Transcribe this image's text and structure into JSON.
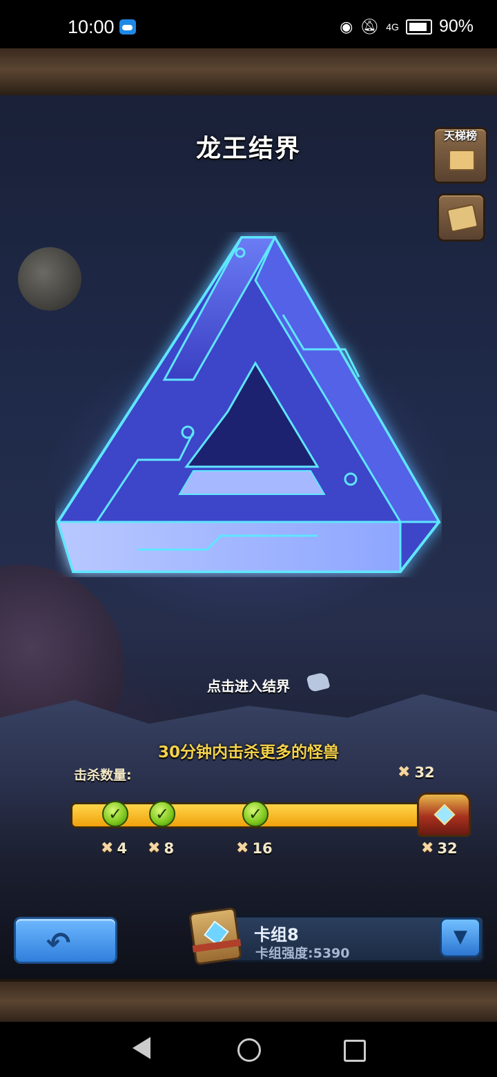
{
  "status_bar": {
    "time": "10:00",
    "battery": "90%",
    "network": "4G"
  },
  "header": {
    "title": "龙王结界"
  },
  "side_buttons": {
    "ladder_label": "天梯榜"
  },
  "portal": {
    "enter_prompt": "点击进入结界"
  },
  "objective": {
    "goal_text": "30分钟内击杀更多的怪兽",
    "kill_label": "击杀数量:",
    "kill_count": "32",
    "progress": 1.0,
    "milestones": [
      {
        "value": "4",
        "completed": true
      },
      {
        "value": "8",
        "completed": true
      },
      {
        "value": "16",
        "completed": true
      },
      {
        "value": "32",
        "completed": true
      }
    ]
  },
  "deck": {
    "name": "卡组8",
    "power_text": "卡组强度:5390"
  },
  "icons": {
    "back": "back-arrow-icon",
    "dropdown": "chevron-down-icon",
    "milestone": "crossed-swords-icon",
    "reward": "treasure-chest-icon"
  },
  "colors": {
    "progress_fill": "#f5b823",
    "goal_text": "#f5d24c",
    "button_blue": "#3f8fe6",
    "portal_glow": "#4ee0ff"
  }
}
